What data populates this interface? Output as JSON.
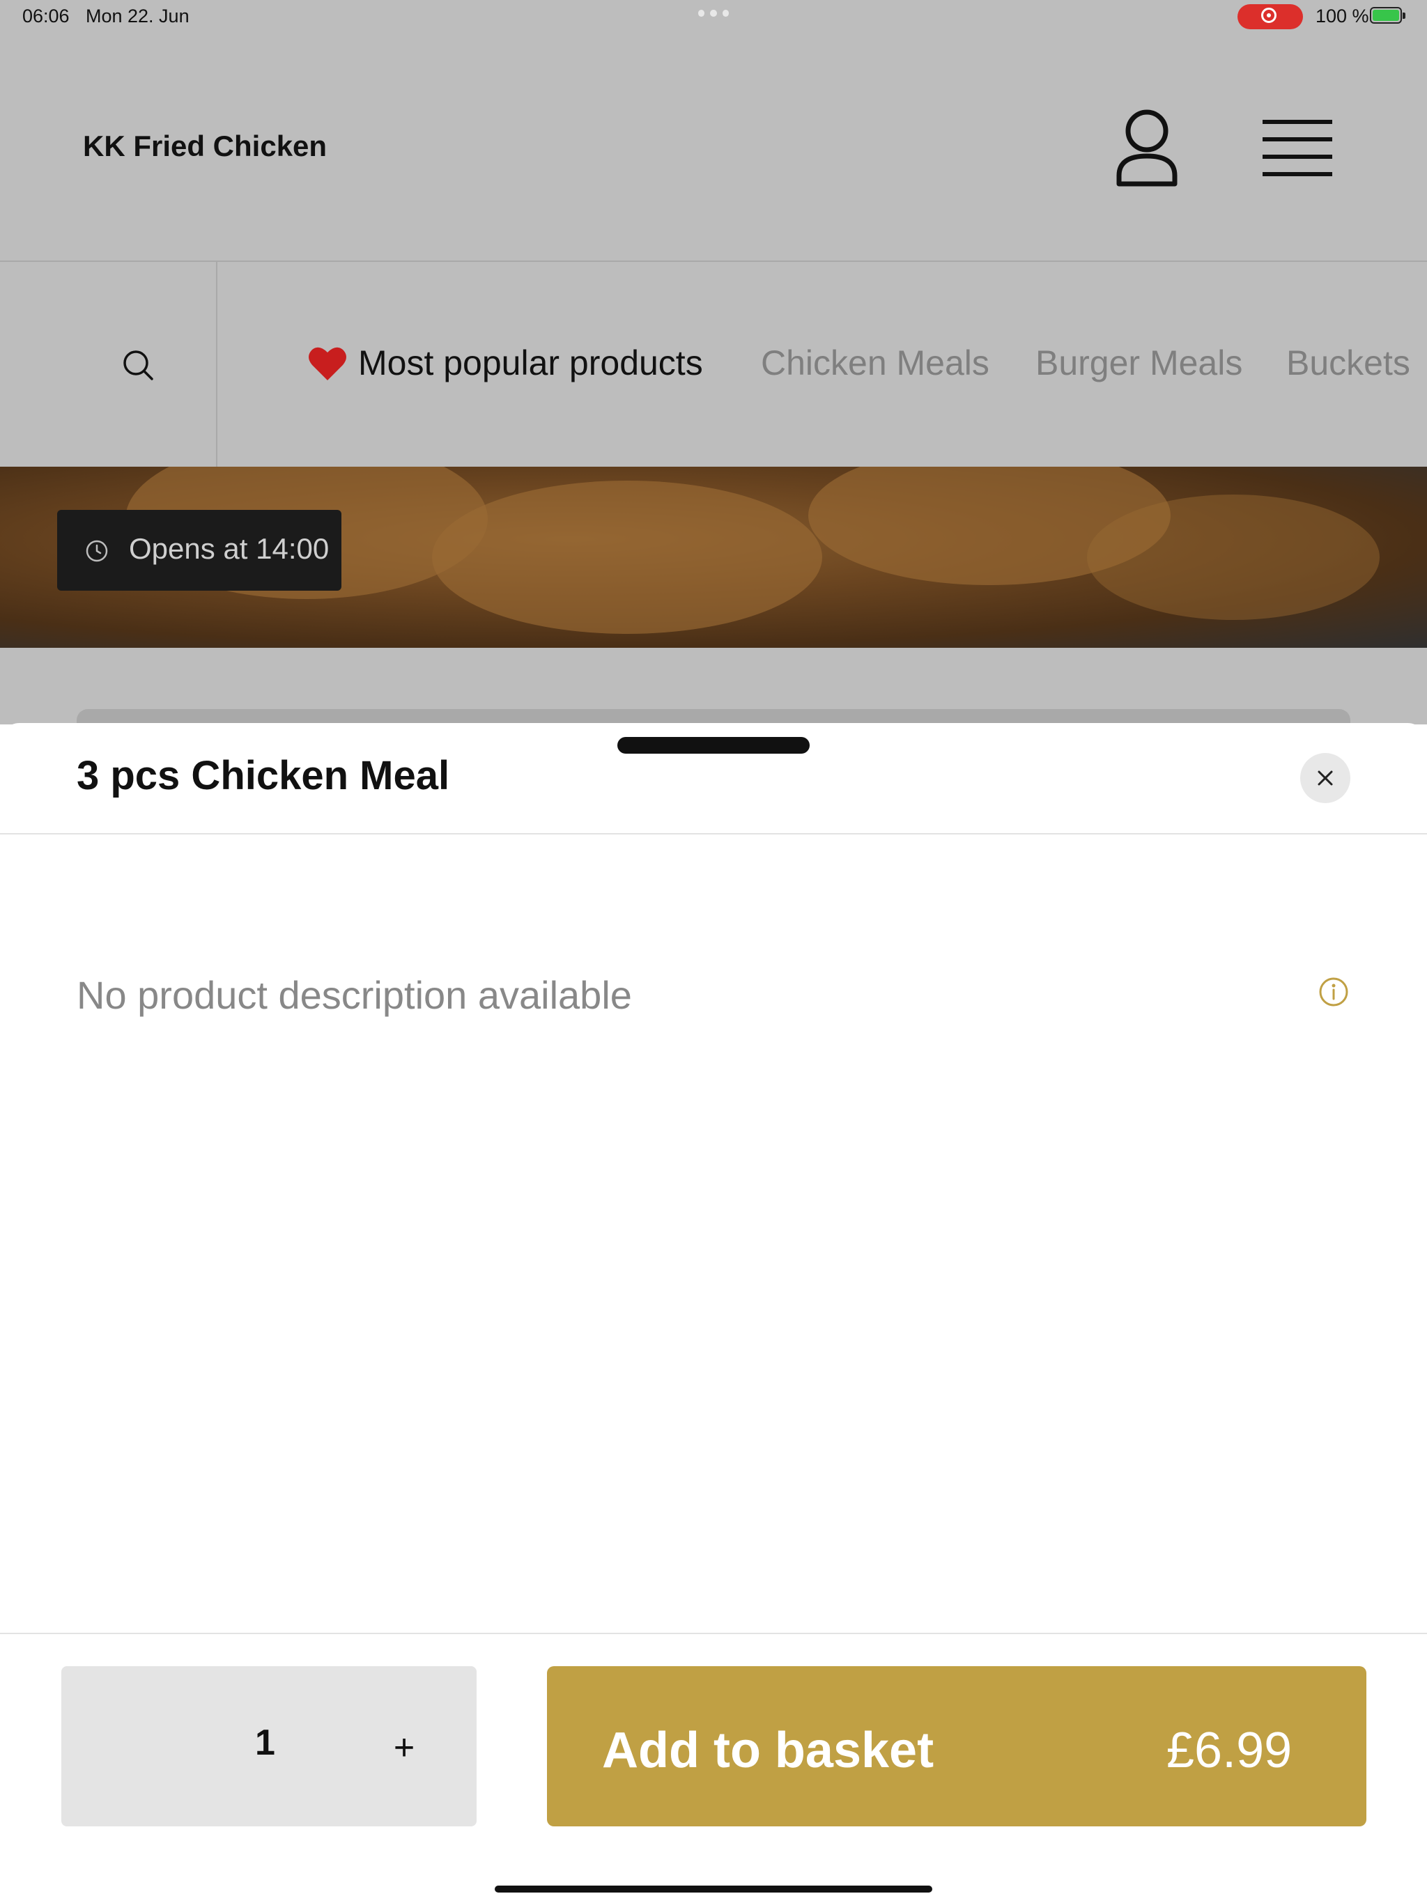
{
  "status_bar": {
    "time": "06:06",
    "date": "Mon 22. Jun",
    "battery": "100 %",
    "icons": [
      "multitasking-dots-icon",
      "screen-recording-icon",
      "battery-charging-icon"
    ]
  },
  "header": {
    "brand": "KK Fried Chicken",
    "icons": [
      "user-icon",
      "menu-icon"
    ]
  },
  "categories": [
    {
      "label": "Most popular products",
      "icon": "heart-icon",
      "active": true
    },
    {
      "label": "Chicken Meals",
      "active": false
    },
    {
      "label": "Burger Meals",
      "active": false
    },
    {
      "label": "Buckets",
      "active": false
    }
  ],
  "hero": {
    "open_text": "Opens at 14:00",
    "icon": "clock-icon"
  },
  "product_sheet": {
    "title": "3 pcs Chicken Meal",
    "description": "No product description available",
    "quantity": "1",
    "plus_label": "+",
    "add_label": "Add to basket",
    "price": "£6.99"
  },
  "colors": {
    "accent": "#c0a044",
    "overlay": "#bdbdbd",
    "recording": "#dc2f2b"
  }
}
